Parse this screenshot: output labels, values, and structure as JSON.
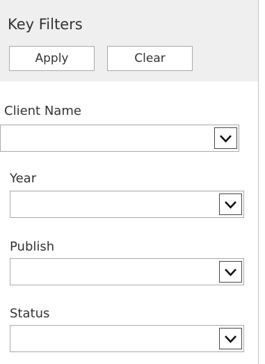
{
  "header": {
    "title": "Key Filters",
    "apply_label": "Apply",
    "clear_label": "Clear"
  },
  "filters": [
    {
      "label": "Client Name",
      "value": ""
    },
    {
      "label": "Year",
      "value": ""
    },
    {
      "label": "Publish",
      "value": ""
    },
    {
      "label": "Status",
      "value": ""
    }
  ],
  "icons": {
    "dropdown": "chevron-down-icon"
  },
  "colors": {
    "header_background": "#efefef",
    "border": "#a9a9a9",
    "text": "#333333"
  }
}
